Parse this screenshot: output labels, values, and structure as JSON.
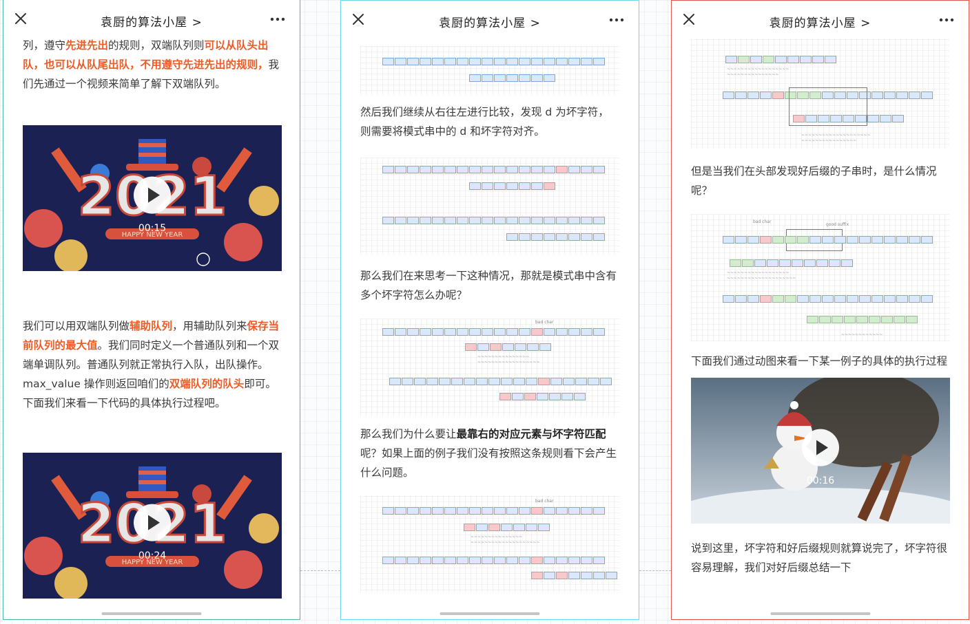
{
  "header": {
    "title": "袁厨的算法小屋 >"
  },
  "phone1": {
    "p1": [
      {
        "t": "列，遵守",
        "c": ""
      },
      {
        "t": "先进先出",
        "c": "hl"
      },
      {
        "t": "的规则，双端队列则",
        "c": ""
      },
      {
        "t": "可以从队头出队，也可以从队尾出队，不用遵守先进先出的规则，",
        "c": "hl"
      },
      {
        "t": "我们先通过一个视频来简单了解下双端队列。",
        "c": ""
      }
    ],
    "video1": {
      "year": "2021",
      "caption": "HAPPY NEW YEAR",
      "time": "00:15"
    },
    "p2": [
      {
        "t": "我们可以用双端队列做",
        "c": ""
      },
      {
        "t": "辅助队列",
        "c": "hl"
      },
      {
        "t": "，用辅助队列来",
        "c": ""
      },
      {
        "t": "保存当前队列的最大值",
        "c": "hl"
      },
      {
        "t": "。我们同时定义一个普通队列和一个双端单调队列。普通队列就正常执行入队，出队操作。max_value 操作则返回咱们的",
        "c": ""
      },
      {
        "t": "双端队列的队头",
        "c": "hl"
      },
      {
        "t": "即可。下面我们来看一下代码的具体执行过程吧。",
        "c": ""
      }
    ],
    "video2": {
      "year": "2021",
      "caption": "HAPPY NEW YEAR",
      "time": "00:24"
    }
  },
  "phone2": {
    "p1": "然后我们继续从右往左进行比较，发现 d 为坏字符，则需要将模式串中的 d 和坏字符对齐。",
    "p2": "那么我们在来思考一下这种情况，那就是模式串中含有多个坏字符怎么办呢？",
    "p3": [
      {
        "t": "那么我们为什么要让",
        "c": ""
      },
      {
        "t": "最靠右的对应元素与坏字符匹配",
        "c": "em"
      },
      {
        "t": "呢？如果上面的例子我们没有按照这条规则看下会产生什么问题。",
        "c": ""
      }
    ]
  },
  "phone3": {
    "p1": "但是当我们在头部发现好后缀的子串时，是什么情况呢？",
    "p2": "下面我们通过动图来看一下某一例子的具体的执行过程",
    "video": {
      "time": "00:16"
    },
    "p3": "说到这里，坏字符和好后缀规则就算说完了，坏字符很容易理解，我们对好后缀总结一下"
  },
  "colors": {
    "highlight": "#f05a24",
    "phone1_border": "#4db6ac",
    "phone2_border": "#6fd6e8",
    "phone3_border": "#e2574c"
  }
}
